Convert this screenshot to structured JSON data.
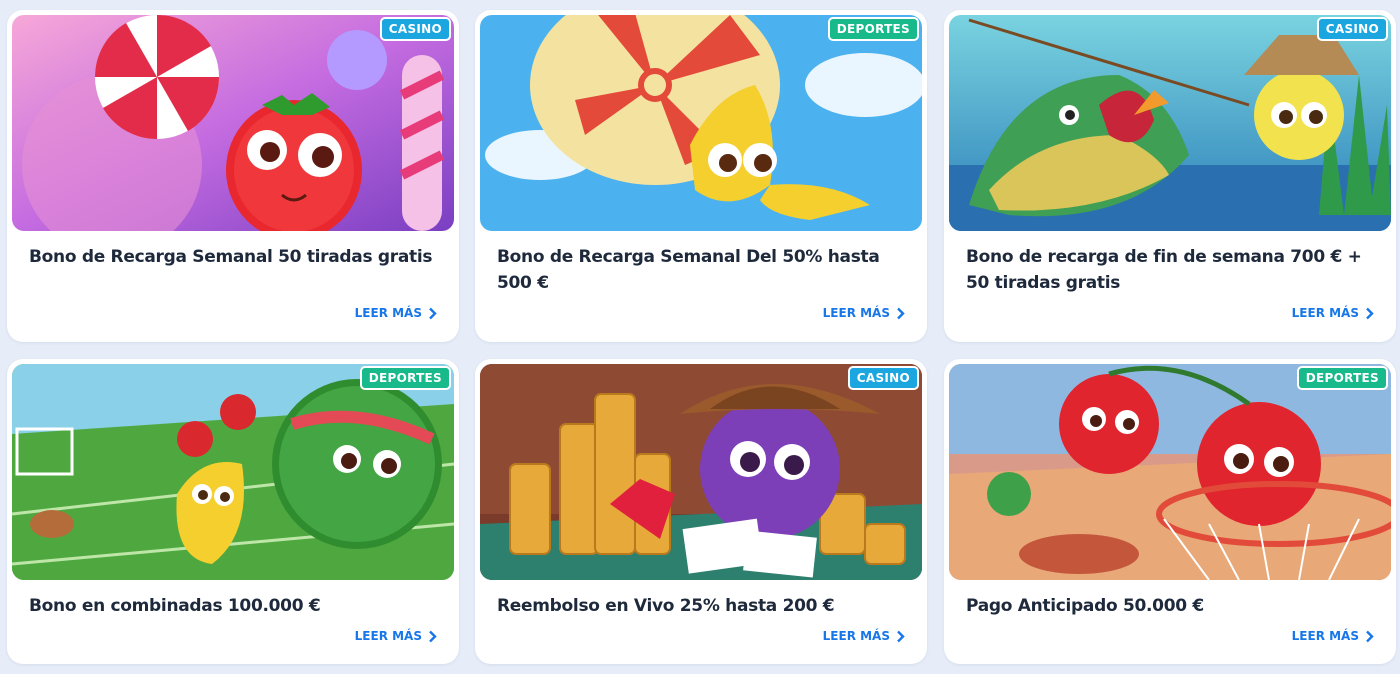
{
  "cards": [
    {
      "badge": "CASINO",
      "title": "Bono de Recarga Semanal 50 tiradas gratis",
      "link": "LEER MÁS"
    },
    {
      "badge": "DEPORTES",
      "title": "Bono de Recarga Semanal Del 50% hasta 500 €",
      "link": "LEER MÁS"
    },
    {
      "badge": "CASINO",
      "title": "Bono de recarga de fin de semana 700 € + 50 tiradas gratis",
      "link": "LEER MÁS"
    },
    {
      "badge": "DEPORTES",
      "title": "Bono en combinadas 100.000 €",
      "link": "LEER MÁS"
    },
    {
      "badge": "CASINO",
      "title": "Reembolso en Vivo 25% hasta 200 €",
      "link": "LEER MÁS"
    },
    {
      "badge": "DEPORTES",
      "title": "Pago Anticipado 50.000 €",
      "link": "LEER MÁS"
    }
  ],
  "colors": {
    "casino": "#1ba6e0",
    "deportes": "#18b98a",
    "link": "#1877e8"
  },
  "icons": {
    "link_icon": "chevron-right-icon"
  }
}
